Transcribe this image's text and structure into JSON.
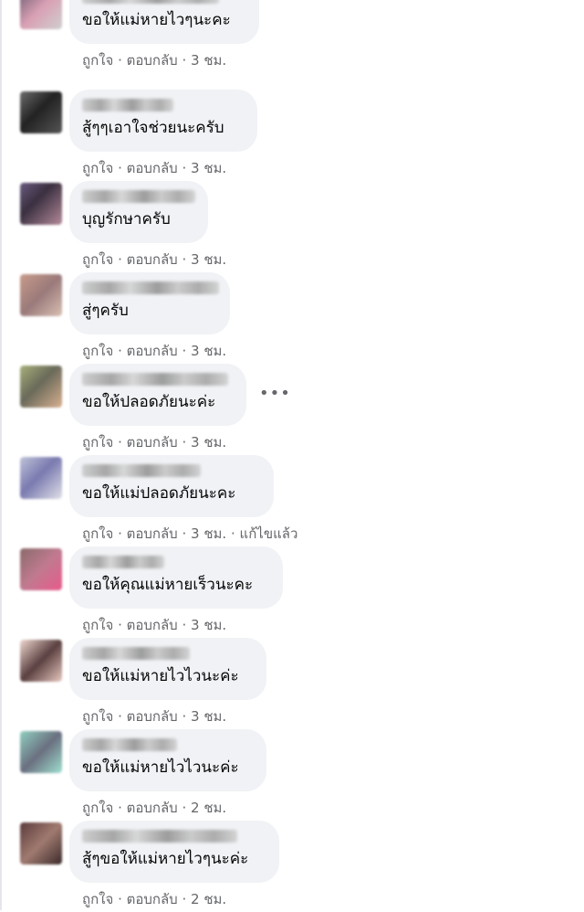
{
  "comments": [
    {
      "text": "ขอให้แม่หายไวๆนะคะ",
      "time": "3 ชม."
    },
    {
      "text": "สู้ๆๆเอาใจช่วยนะครับ",
      "time": "3 ชม."
    },
    {
      "text": "บุญรักษาครับ",
      "time": "3 ชม."
    },
    {
      "text": "สู่ๆครับ",
      "time": "3 ชม."
    },
    {
      "text": "ขอให้ปลอดภัยนะค่ะ",
      "time": "3 ชม."
    },
    {
      "text": "ขอให้แม่ปลอดภัยนะคะ",
      "time": "3 ชม.",
      "edited": "แก้ไขแล้ว"
    },
    {
      "text": "ขอให้คุณแม่หายเร็วนะคะ",
      "time": "3 ชม."
    },
    {
      "text": "ขอให้แม่หายไวไวนะค่ะ",
      "time": "3 ชม."
    },
    {
      "text": "ขอให้แม่หายไวไวนะค่ะ",
      "time": "2 ชม."
    },
    {
      "text": "สู้ๆขอให้แม่หายไวๆนะค่ะ",
      "time": "2 ชม."
    }
  ],
  "actions": {
    "like": "ถูกใจ",
    "reply": "ตอบกลับ",
    "separator": "·"
  },
  "more_options_icon": "more-horizontal-icon",
  "colors": {
    "bubble": "#f0f2f5",
    "meta": "#65676b",
    "text": "#050505"
  }
}
